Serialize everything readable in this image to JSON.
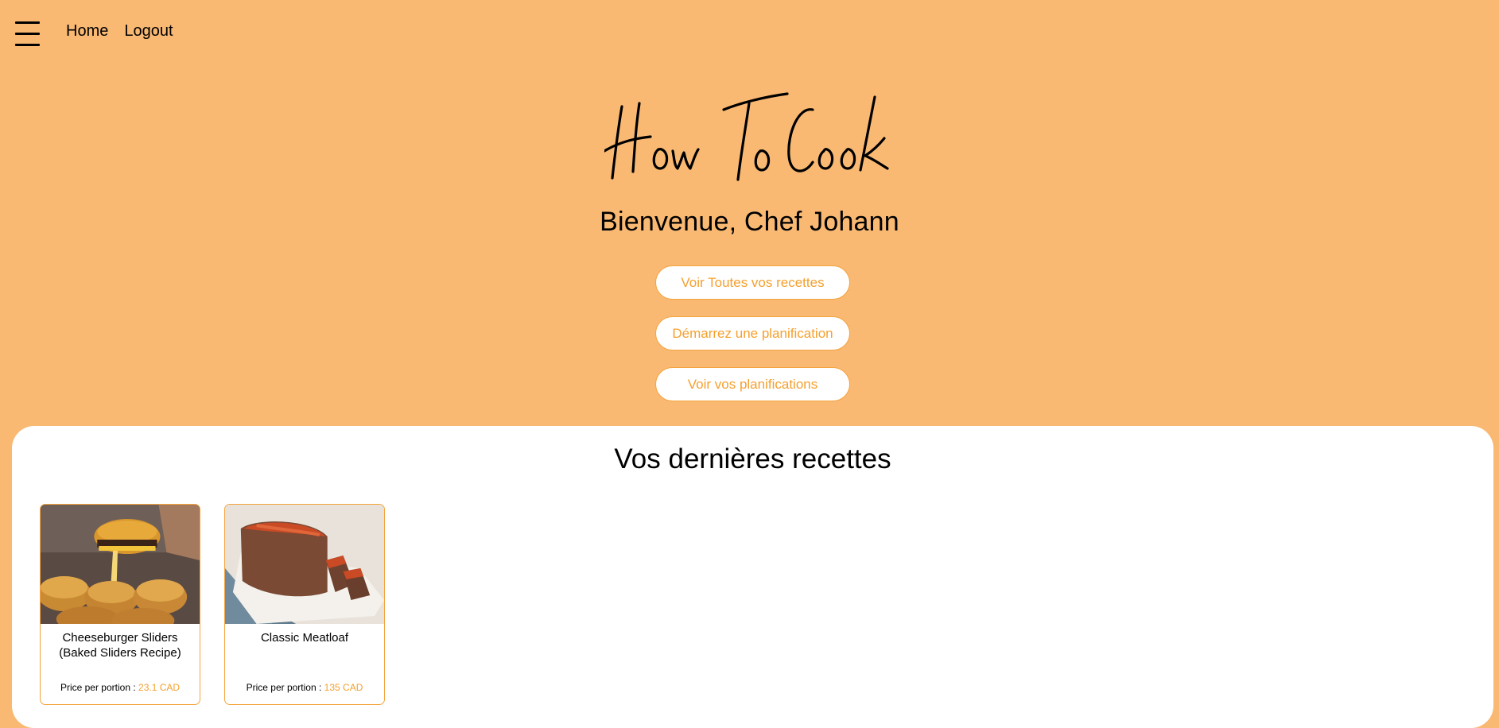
{
  "nav": {
    "home": "Home",
    "logout": "Logout"
  },
  "brand": {
    "logo_text": "How To Cook"
  },
  "welcome": "Bienvenue, Chef Johann",
  "actions": {
    "all_recipes": "Voir Toutes vos recettes",
    "start_planning": "Démarrez une planification",
    "view_plannings": "Voir vos planifications"
  },
  "recent": {
    "title": "Vos dernières recettes",
    "price_label": "Price per portion :",
    "recipes": [
      {
        "title": "Cheeseburger Sliders (Baked Sliders Recipe)",
        "price": "23.1 CAD",
        "image": "cheeseburger-sliders-photo"
      },
      {
        "title": "Classic Meatloaf",
        "price": "135 CAD",
        "image": "meatloaf-photo"
      }
    ]
  },
  "colors": {
    "background": "#F9B973",
    "accent": "#F5A02E",
    "panel": "#FFFFFF"
  },
  "icons": {
    "menu": "hamburger-menu-icon"
  }
}
